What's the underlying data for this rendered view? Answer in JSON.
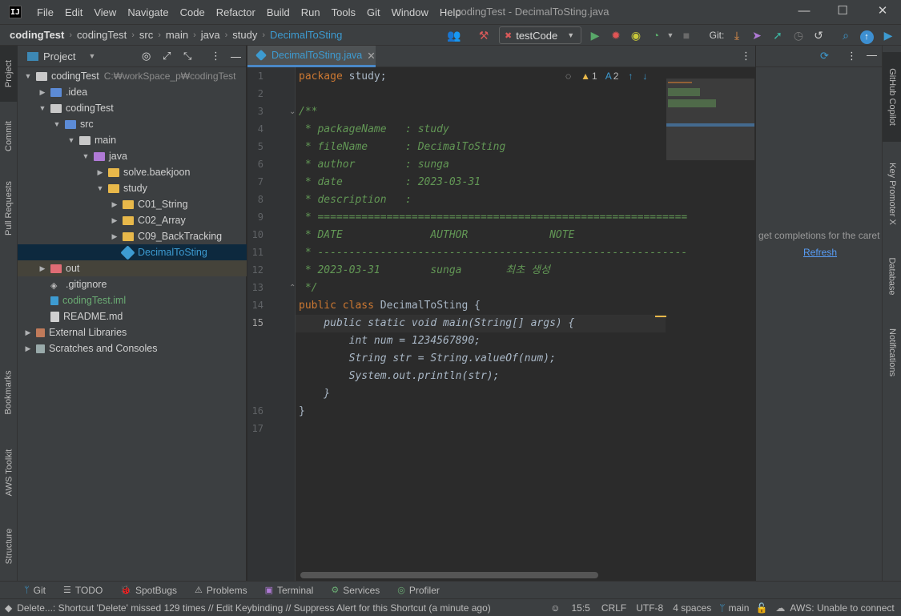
{
  "app": {
    "logo": "IJ",
    "window_title": "codingTest - DecimalToSting.java"
  },
  "menu": [
    "File",
    "Edit",
    "View",
    "Navigate",
    "Code",
    "Refactor",
    "Build",
    "Run",
    "Tools",
    "Git",
    "Window",
    "Help"
  ],
  "window_buttons": {
    "minimize": "—",
    "maximize": "☐",
    "close": "✕"
  },
  "breadcrumbs": [
    "codingTest",
    "codingTest",
    "src",
    "main",
    "java",
    "study",
    "DecimalToSting"
  ],
  "toolbar": {
    "run_config": "testCode",
    "git_label": "Git:"
  },
  "left_stripe": [
    "Project",
    "Commit",
    "Pull Requests",
    "Bookmarks",
    "AWS Toolkit",
    "Structure"
  ],
  "project_panel": {
    "title": "Project",
    "tree": [
      {
        "label": "codingTest",
        "detail": "C:₩workSpace_p₩codingTest",
        "depth": 0,
        "expanded": true,
        "icon": "folder"
      },
      {
        "label": ".idea",
        "depth": 1,
        "expanded": false,
        "icon": "folder-blue"
      },
      {
        "label": "codingTest",
        "depth": 1,
        "expanded": true,
        "icon": "folder"
      },
      {
        "label": "src",
        "depth": 2,
        "expanded": true,
        "icon": "folder-blue"
      },
      {
        "label": "main",
        "depth": 3,
        "expanded": true,
        "icon": "folder"
      },
      {
        "label": "java",
        "depth": 4,
        "expanded": true,
        "icon": "folder-purple"
      },
      {
        "label": "solve.baekjoon",
        "depth": 5,
        "expanded": false,
        "icon": "folder-yellow"
      },
      {
        "label": "study",
        "depth": 5,
        "expanded": true,
        "icon": "folder-yellow"
      },
      {
        "label": "C01_String",
        "depth": 6,
        "expanded": false,
        "icon": "folder-yellow"
      },
      {
        "label": "C02_Array",
        "depth": 6,
        "expanded": false,
        "icon": "folder-yellow"
      },
      {
        "label": "C09_BackTracking",
        "depth": 6,
        "expanded": false,
        "icon": "folder-yellow"
      },
      {
        "label": "DecimalToSting",
        "depth": 6,
        "icon": "java",
        "selected": true
      },
      {
        "label": "out",
        "depth": 1,
        "expanded": false,
        "icon": "folder-out",
        "hover": true
      },
      {
        "label": ".gitignore",
        "depth": 1,
        "icon": "git"
      },
      {
        "label": "codingTest.iml",
        "depth": 1,
        "icon": "iml"
      },
      {
        "label": "README.md",
        "depth": 1,
        "icon": "md"
      },
      {
        "label": "External Libraries",
        "depth": 0,
        "expanded": false,
        "icon": "lib"
      },
      {
        "label": "Scratches and Consoles",
        "depth": 0,
        "expanded": false,
        "icon": "scratch"
      }
    ]
  },
  "editor": {
    "tab": "DecimalToSting.java",
    "inspection": {
      "warnings": "1",
      "typos": "2"
    },
    "line_numbers": [
      "1",
      "2",
      "3",
      "4",
      "5",
      "6",
      "7",
      "8",
      "9",
      "10",
      "11",
      "12",
      "13",
      "14",
      "15",
      "",
      "",
      "",
      "",
      "16",
      "17"
    ],
    "current_line": "15",
    "lines": [
      [
        {
          "t": "package ",
          "c": "kw"
        },
        {
          "t": "study;",
          "c": "plain"
        }
      ],
      [],
      [
        {
          "t": "/**",
          "c": "cm"
        }
      ],
      [
        {
          "t": " * packageName   : study",
          "c": "cm"
        }
      ],
      [
        {
          "t": " * fileName      : DecimalToSting",
          "c": "cm"
        }
      ],
      [
        {
          "t": " * author        : sunga",
          "c": "cm"
        }
      ],
      [
        {
          "t": " * date          : 2023-03-31",
          "c": "cm"
        }
      ],
      [
        {
          "t": " * description   :",
          "c": "cm"
        }
      ],
      [
        {
          "t": " * ===========================================================",
          "c": "cm"
        }
      ],
      [
        {
          "t": " * DATE              AUTHOR             NOTE",
          "c": "cm"
        }
      ],
      [
        {
          "t": " * -----------------------------------------------------------",
          "c": "cm"
        }
      ],
      [
        {
          "t": " * 2023-03-31        sunga       최초 생성",
          "c": "cm"
        }
      ],
      [
        {
          "t": " */",
          "c": "cm"
        }
      ],
      [
        {
          "t": "public class ",
          "c": "kw"
        },
        {
          "t": "DecimalToSting {",
          "c": "plain"
        }
      ],
      [
        {
          "t": "    public static void main(String[] args) {",
          "c": "fold"
        }
      ],
      [
        {
          "t": "        int num = 1234567890;",
          "c": "fold"
        }
      ],
      [
        {
          "t": "        String str = String.valueOf(num);",
          "c": "fold"
        }
      ],
      [
        {
          "t": "        System.out.println(str);",
          "c": "fold"
        }
      ],
      [
        {
          "t": "    }",
          "c": "fold"
        }
      ],
      [
        {
          "t": "}",
          "c": "plain"
        }
      ],
      []
    ]
  },
  "copilot_panel": {
    "message": "get completions for the caret",
    "refresh_link": "Refresh"
  },
  "right_stripe": [
    "GitHub Copilot",
    "Key Promoter X",
    "Database",
    "Notifications"
  ],
  "tool_windows": [
    "Git",
    "TODO",
    "SpotBugs",
    "Problems",
    "Terminal",
    "Services",
    "Profiler"
  ],
  "status": {
    "message": "Delete...: Shortcut 'Delete' missed 129 times // Edit Keybinding // Suppress Alert for this Shortcut (a minute ago)",
    "position": "15:5",
    "line_sep": "CRLF",
    "encoding": "UTF-8",
    "indent": "4 spaces",
    "branch": "main",
    "aws": "AWS: Unable to connect"
  },
  "colors": {
    "keyword": "#cc7832",
    "comment": "#629755",
    "text": "#a9b7c6",
    "selection": "#0d293e",
    "accent": "#3d9bd1"
  }
}
